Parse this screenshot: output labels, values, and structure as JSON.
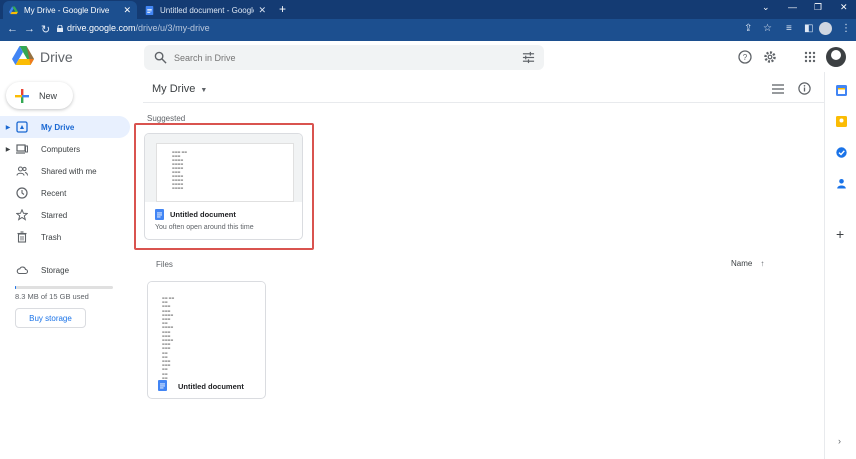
{
  "browser": {
    "tabs": [
      {
        "title": "My Drive - Google Drive",
        "active": true
      },
      {
        "title": "Untitled document - Google Do",
        "active": false
      }
    ],
    "url_host": "drive.google.com",
    "url_path": "/drive/u/3/my-drive"
  },
  "header": {
    "brand": "Drive",
    "search_placeholder": "Search in Drive"
  },
  "sidebar": {
    "new_label": "New",
    "items": [
      {
        "label": "My Drive",
        "icon": "my-drive-icon",
        "active": true,
        "caret": true
      },
      {
        "label": "Computers",
        "icon": "computers-icon",
        "active": false,
        "caret": true
      },
      {
        "label": "Shared with me",
        "icon": "shared-icon",
        "active": false,
        "caret": false
      },
      {
        "label": "Recent",
        "icon": "clock-icon",
        "active": false,
        "caret": false
      },
      {
        "label": "Starred",
        "icon": "star-icon",
        "active": false,
        "caret": false
      },
      {
        "label": "Trash",
        "icon": "trash-icon",
        "active": false,
        "caret": false
      }
    ],
    "storage_label": "Storage",
    "storage_used": "8.3 MB of 15 GB used",
    "storage_fraction": 0.0006,
    "buy_storage": "Buy storage"
  },
  "main": {
    "title": "My Drive",
    "suggested_label": "Suggested",
    "suggested_card": {
      "title": "Untitled document",
      "subtitle": "You often open around this time"
    },
    "files_label": "Files",
    "sort_label": "Name",
    "file_card": {
      "title": "Untitled document"
    }
  },
  "colors": {
    "accent": "#1a73e8",
    "active_bg": "#e8f0fe",
    "highlight": "#d9534f",
    "chrome": "#1c4f8f"
  }
}
